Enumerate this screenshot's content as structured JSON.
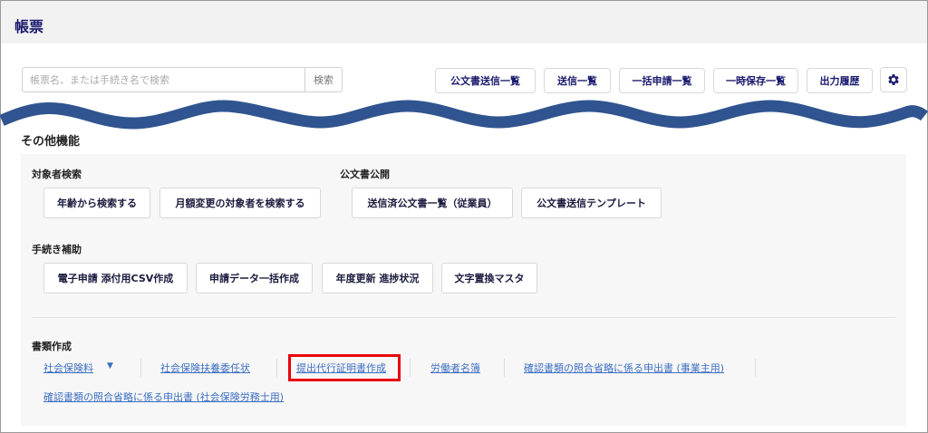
{
  "header": {
    "title": "帳票"
  },
  "search": {
    "placeholder": "帳票名、または手続き名で検索",
    "button": "検索"
  },
  "toolbar": [
    "公文書送信一覧",
    "送信一覧",
    "一括申請一覧",
    "一時保存一覧",
    "出力履歴"
  ],
  "toolbar_settings_icon": "gear-icon",
  "section_title": "その他機能",
  "groups": {
    "target_search": {
      "label": "対象者検索",
      "buttons": [
        "年齢から検索する",
        "月額変更の対象者を検索する"
      ]
    },
    "public_docs": {
      "label": "公文書公開",
      "buttons": [
        "送信済公文書一覧（従業員）",
        "公文書送信テンプレート"
      ]
    },
    "procedure_help": {
      "label": "手続き補助",
      "buttons": [
        "電子申請 添付用CSV作成",
        "申請データ一括作成",
        "年度更新 進捗状況",
        "文字置換マスタ"
      ]
    },
    "documents": {
      "label": "書類作成",
      "links": [
        "社会保険料",
        "社会保険扶養委任状",
        "提出代行証明書作成",
        "労働者名簿",
        "確認書類の照合省略に係る申出書 (事業主用)",
        "確認書類の照合省略に係る申出書 (社会保険労務士用)"
      ]
    }
  },
  "colors": {
    "title": "#1a1a6e",
    "wave": "#30548f",
    "link": "#3d6fc2",
    "highlight": "#e8000b"
  }
}
